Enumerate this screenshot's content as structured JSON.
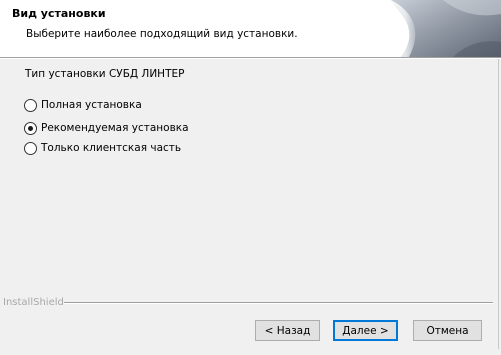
{
  "header": {
    "title": "Вид установки",
    "subtitle": "Выберите наиболее подходящий вид установки."
  },
  "setup_type": {
    "group_label": "Тип установки СУБД ЛИНТЕР",
    "options": [
      {
        "label": "Полная установка",
        "selected": false
      },
      {
        "label": "Рекомендуемая установка",
        "selected": true
      },
      {
        "label": "Только клиентская часть",
        "selected": false
      }
    ]
  },
  "footer": {
    "brand": "InstallShield",
    "back_label": "< Назад",
    "next_label": "Далее >",
    "cancel_label": "Отмена"
  }
}
